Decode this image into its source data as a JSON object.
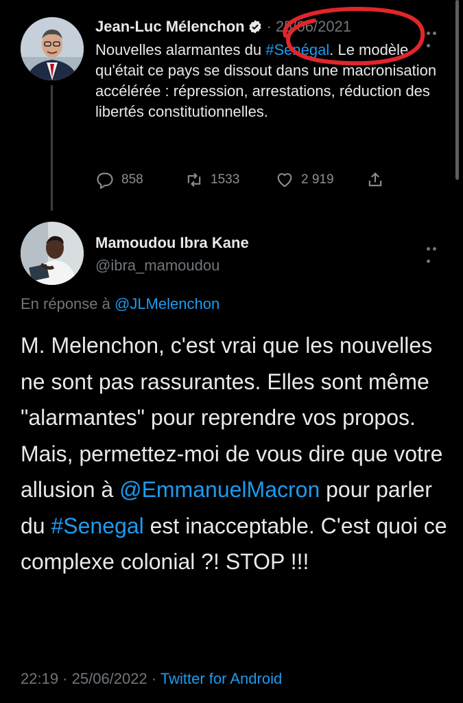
{
  "tweet1": {
    "author_name": "Jean-Luc Mélenchon",
    "separator": "·",
    "date": "25/06/2021",
    "text_before": "Nouvelles alarmantes du ",
    "hashtag": "#Sénégal",
    "text_after": ". Le modèle qu'était ce pays se dissout dans une macronisation accélérée : répression, arrestations, réduction des libertés constitutionnelles.",
    "replies": "858",
    "retweets": "1533",
    "likes": "2 919"
  },
  "tweet2": {
    "author_name": "Mamoudou Ibra Kane",
    "handle": "@ibra_mamoudou",
    "reply_prefix": "En réponse à ",
    "reply_handle": "@JLMelenchon",
    "text_part1": "M. Melenchon, c'est vrai que les nouvelles ne sont pas rassurantes. Elles sont même \"alarmantes\" pour reprendre vos propos. Mais, permettez-moi de vous dire que votre allusion à ",
    "mention": "@EmmanuelMacron",
    "text_part2": " pour parler du ",
    "hashtag": "#Senegal",
    "text_part3": " est inacceptable. C'est quoi ce complexe colonial ?! STOP !!!",
    "time": "22:19",
    "separator": " · ",
    "date": "25/06/2022",
    "separator2": " · ",
    "source": "Twitter for Android"
  },
  "colors": {
    "background": "#000000",
    "text": "#e7e9ea",
    "muted": "#71767b",
    "link": "#1d9bf0",
    "annotation": "#e0262b"
  },
  "icons": [
    "verified-badge-icon",
    "more-icon",
    "reply-icon",
    "retweet-icon",
    "like-icon",
    "share-icon"
  ]
}
